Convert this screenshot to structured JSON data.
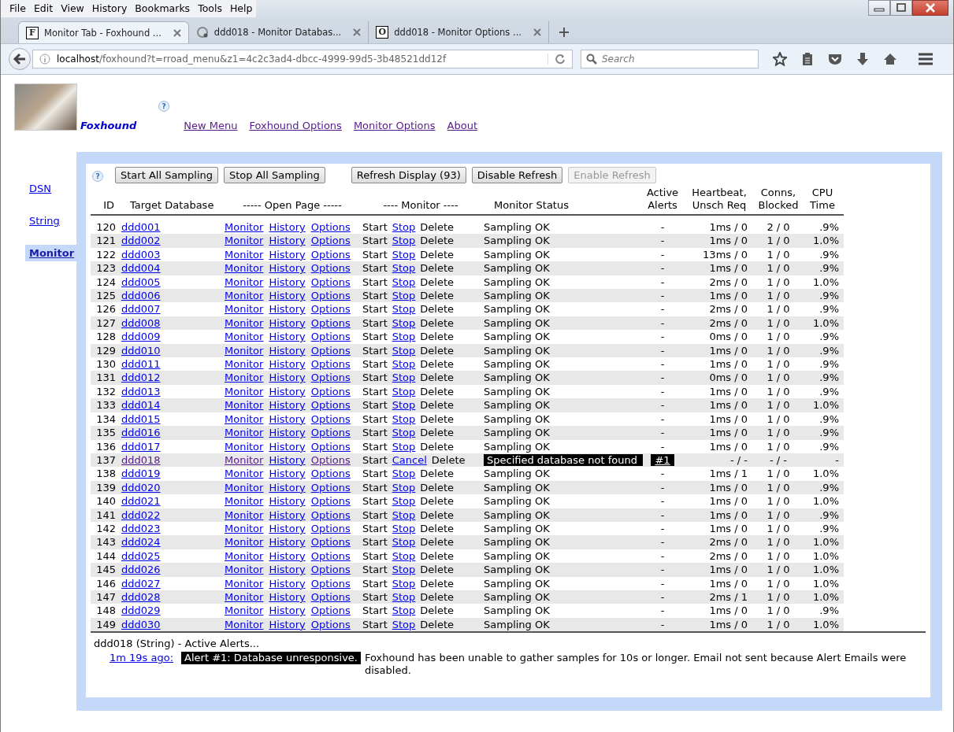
{
  "menu": [
    "File",
    "Edit",
    "View",
    "History",
    "Bookmarks",
    "Tools",
    "Help"
  ],
  "tabs": [
    {
      "label": "Monitor Tab - Foxhound ...",
      "kind": "letter",
      "letter": "F",
      "selected": true
    },
    {
      "label": "ddd018 - Monitor Databas...",
      "kind": "spinner",
      "selected": false
    },
    {
      "label": "ddd018 - Monitor Options ...",
      "kind": "letter",
      "letter": "O",
      "selected": false
    }
  ],
  "address": {
    "host": "localhost",
    "path": "/foxhound?t=rroad_menu&z1=4c2c3ad4-dbcc-4999-99d5-3b48521dd12f"
  },
  "search": {
    "placeholder": "Search"
  },
  "header": {
    "title": "Foxhound",
    "help": "?",
    "links": [
      {
        "label": "New Menu",
        "visited": true
      },
      {
        "label": "Foxhound Options",
        "visited": true
      },
      {
        "label": "Monitor Options",
        "visited": true
      },
      {
        "label": "About",
        "visited": true
      }
    ]
  },
  "sidebar": [
    {
      "label": "DSN",
      "selected": false
    },
    {
      "label": "String",
      "selected": false
    },
    {
      "label": "Monitor",
      "selected": true
    }
  ],
  "toolbar": {
    "help": "?",
    "buttons": [
      {
        "label": "Start All Sampling",
        "disabled": false
      },
      {
        "label": "Stop All Sampling",
        "disabled": false
      },
      {
        "label": "Refresh Display (93)",
        "disabled": false
      },
      {
        "label": "Disable Refresh",
        "disabled": false
      },
      {
        "label": "Enable Refresh",
        "disabled": true
      }
    ]
  },
  "columns": [
    [
      "ID"
    ],
    [
      "Target Database"
    ],
    [
      "----- Open Page -----"
    ],
    [
      "---- Monitor ----"
    ],
    [
      "Monitor Status"
    ],
    [
      "Active",
      "Alerts"
    ],
    [
      "Heartbeat,",
      "Unsch Req"
    ],
    [
      "Conns,",
      "Blocked"
    ],
    [
      "CPU",
      "Time"
    ]
  ],
  "rows": [
    {
      "id": "120",
      "db": "ddd001",
      "visited": false,
      "links": [
        "Monitor",
        "History",
        "Options"
      ],
      "start": "Start",
      "control": "Stop",
      "delete": "Delete",
      "status": "Sampling OK",
      "error": false,
      "alerts": "-",
      "alert_link": false,
      "heartbeat": "1ms / 0",
      "conns": "2 / 0",
      "cpu": ".9%"
    },
    {
      "id": "121",
      "db": "ddd002",
      "visited": false,
      "links": [
        "Monitor",
        "History",
        "Options"
      ],
      "start": "Start",
      "control": "Stop",
      "delete": "Delete",
      "status": "Sampling OK",
      "error": false,
      "alerts": "-",
      "alert_link": false,
      "heartbeat": "1ms / 0",
      "conns": "1 / 0",
      "cpu": "1.0%"
    },
    {
      "id": "122",
      "db": "ddd003",
      "visited": false,
      "links": [
        "Monitor",
        "History",
        "Options"
      ],
      "start": "Start",
      "control": "Stop",
      "delete": "Delete",
      "status": "Sampling OK",
      "error": false,
      "alerts": "-",
      "alert_link": false,
      "heartbeat": "13ms / 0",
      "conns": "1 / 0",
      "cpu": ".9%"
    },
    {
      "id": "123",
      "db": "ddd004",
      "visited": false,
      "links": [
        "Monitor",
        "History",
        "Options"
      ],
      "start": "Start",
      "control": "Stop",
      "delete": "Delete",
      "status": "Sampling OK",
      "error": false,
      "alerts": "-",
      "alert_link": false,
      "heartbeat": "1ms / 0",
      "conns": "1 / 0",
      "cpu": ".9%"
    },
    {
      "id": "124",
      "db": "ddd005",
      "visited": false,
      "links": [
        "Monitor",
        "History",
        "Options"
      ],
      "start": "Start",
      "control": "Stop",
      "delete": "Delete",
      "status": "Sampling OK",
      "error": false,
      "alerts": "-",
      "alert_link": false,
      "heartbeat": "2ms / 0",
      "conns": "1 / 0",
      "cpu": "1.0%"
    },
    {
      "id": "125",
      "db": "ddd006",
      "visited": false,
      "links": [
        "Monitor",
        "History",
        "Options"
      ],
      "start": "Start",
      "control": "Stop",
      "delete": "Delete",
      "status": "Sampling OK",
      "error": false,
      "alerts": "-",
      "alert_link": false,
      "heartbeat": "1ms / 0",
      "conns": "1 / 0",
      "cpu": ".9%"
    },
    {
      "id": "126",
      "db": "ddd007",
      "visited": false,
      "links": [
        "Monitor",
        "History",
        "Options"
      ],
      "start": "Start",
      "control": "Stop",
      "delete": "Delete",
      "status": "Sampling OK",
      "error": false,
      "alerts": "-",
      "alert_link": false,
      "heartbeat": "2ms / 0",
      "conns": "1 / 0",
      "cpu": ".9%"
    },
    {
      "id": "127",
      "db": "ddd008",
      "visited": false,
      "links": [
        "Monitor",
        "History",
        "Options"
      ],
      "start": "Start",
      "control": "Stop",
      "delete": "Delete",
      "status": "Sampling OK",
      "error": false,
      "alerts": "-",
      "alert_link": false,
      "heartbeat": "2ms / 0",
      "conns": "1 / 0",
      "cpu": "1.0%"
    },
    {
      "id": "128",
      "db": "ddd009",
      "visited": false,
      "links": [
        "Monitor",
        "History",
        "Options"
      ],
      "start": "Start",
      "control": "Stop",
      "delete": "Delete",
      "status": "Sampling OK",
      "error": false,
      "alerts": "-",
      "alert_link": false,
      "heartbeat": "0ms / 0",
      "conns": "1 / 0",
      "cpu": ".9%"
    },
    {
      "id": "129",
      "db": "ddd010",
      "visited": false,
      "links": [
        "Monitor",
        "History",
        "Options"
      ],
      "start": "Start",
      "control": "Stop",
      "delete": "Delete",
      "status": "Sampling OK",
      "error": false,
      "alerts": "-",
      "alert_link": false,
      "heartbeat": "1ms / 0",
      "conns": "1 / 0",
      "cpu": ".9%"
    },
    {
      "id": "130",
      "db": "ddd011",
      "visited": false,
      "links": [
        "Monitor",
        "History",
        "Options"
      ],
      "start": "Start",
      "control": "Stop",
      "delete": "Delete",
      "status": "Sampling OK",
      "error": false,
      "alerts": "-",
      "alert_link": false,
      "heartbeat": "1ms / 0",
      "conns": "1 / 0",
      "cpu": ".9%"
    },
    {
      "id": "131",
      "db": "ddd012",
      "visited": false,
      "links": [
        "Monitor",
        "History",
        "Options"
      ],
      "start": "Start",
      "control": "Stop",
      "delete": "Delete",
      "status": "Sampling OK",
      "error": false,
      "alerts": "-",
      "alert_link": false,
      "heartbeat": "0ms / 0",
      "conns": "1 / 0",
      "cpu": ".9%"
    },
    {
      "id": "132",
      "db": "ddd013",
      "visited": false,
      "links": [
        "Monitor",
        "History",
        "Options"
      ],
      "start": "Start",
      "control": "Stop",
      "delete": "Delete",
      "status": "Sampling OK",
      "error": false,
      "alerts": "-",
      "alert_link": false,
      "heartbeat": "1ms / 0",
      "conns": "1 / 0",
      "cpu": ".9%"
    },
    {
      "id": "133",
      "db": "ddd014",
      "visited": false,
      "links": [
        "Monitor",
        "History",
        "Options"
      ],
      "start": "Start",
      "control": "Stop",
      "delete": "Delete",
      "status": "Sampling OK",
      "error": false,
      "alerts": "-",
      "alert_link": false,
      "heartbeat": "1ms / 0",
      "conns": "1 / 0",
      "cpu": "1.0%"
    },
    {
      "id": "134",
      "db": "ddd015",
      "visited": false,
      "links": [
        "Monitor",
        "History",
        "Options"
      ],
      "start": "Start",
      "control": "Stop",
      "delete": "Delete",
      "status": "Sampling OK",
      "error": false,
      "alerts": "-",
      "alert_link": false,
      "heartbeat": "1ms / 0",
      "conns": "1 / 0",
      "cpu": ".9%"
    },
    {
      "id": "135",
      "db": "ddd016",
      "visited": false,
      "links": [
        "Monitor",
        "History",
        "Options"
      ],
      "start": "Start",
      "control": "Stop",
      "delete": "Delete",
      "status": "Sampling OK",
      "error": false,
      "alerts": "-",
      "alert_link": false,
      "heartbeat": "1ms / 0",
      "conns": "1 / 0",
      "cpu": ".9%"
    },
    {
      "id": "136",
      "db": "ddd017",
      "visited": false,
      "links": [
        "Monitor",
        "History",
        "Options"
      ],
      "start": "Start",
      "control": "Stop",
      "delete": "Delete",
      "status": "Sampling OK",
      "error": false,
      "alerts": "-",
      "alert_link": false,
      "heartbeat": "1ms / 0",
      "conns": "1 / 0",
      "cpu": ".9%"
    },
    {
      "id": "137",
      "db": "ddd018",
      "visited": true,
      "links": [
        "Monitor",
        "History",
        "Options"
      ],
      "start": "Start",
      "control": "Cancel",
      "delete": "Delete",
      "status": "Specified database not found",
      "error": true,
      "alerts": "#1",
      "alert_link": true,
      "heartbeat": "- / -",
      "conns": "- / -",
      "cpu": "-"
    },
    {
      "id": "138",
      "db": "ddd019",
      "visited": false,
      "links": [
        "Monitor",
        "History",
        "Options"
      ],
      "start": "Start",
      "control": "Stop",
      "delete": "Delete",
      "status": "Sampling OK",
      "error": false,
      "alerts": "-",
      "alert_link": false,
      "heartbeat": "1ms / 1",
      "conns": "1 / 0",
      "cpu": "1.0%"
    },
    {
      "id": "139",
      "db": "ddd020",
      "visited": false,
      "links": [
        "Monitor",
        "History",
        "Options"
      ],
      "start": "Start",
      "control": "Stop",
      "delete": "Delete",
      "status": "Sampling OK",
      "error": false,
      "alerts": "-",
      "alert_link": false,
      "heartbeat": "1ms / 0",
      "conns": "1 / 0",
      "cpu": ".9%"
    },
    {
      "id": "140",
      "db": "ddd021",
      "visited": false,
      "links": [
        "Monitor",
        "History",
        "Options"
      ],
      "start": "Start",
      "control": "Stop",
      "delete": "Delete",
      "status": "Sampling OK",
      "error": false,
      "alerts": "-",
      "alert_link": false,
      "heartbeat": "1ms / 0",
      "conns": "1 / 0",
      "cpu": "1.0%"
    },
    {
      "id": "141",
      "db": "ddd022",
      "visited": false,
      "links": [
        "Monitor",
        "History",
        "Options"
      ],
      "start": "Start",
      "control": "Stop",
      "delete": "Delete",
      "status": "Sampling OK",
      "error": false,
      "alerts": "-",
      "alert_link": false,
      "heartbeat": "1ms / 0",
      "conns": "1 / 0",
      "cpu": ".9%"
    },
    {
      "id": "142",
      "db": "ddd023",
      "visited": false,
      "links": [
        "Monitor",
        "History",
        "Options"
      ],
      "start": "Start",
      "control": "Stop",
      "delete": "Delete",
      "status": "Sampling OK",
      "error": false,
      "alerts": "-",
      "alert_link": false,
      "heartbeat": "1ms / 0",
      "conns": "1 / 0",
      "cpu": ".9%"
    },
    {
      "id": "143",
      "db": "ddd024",
      "visited": false,
      "links": [
        "Monitor",
        "History",
        "Options"
      ],
      "start": "Start",
      "control": "Stop",
      "delete": "Delete",
      "status": "Sampling OK",
      "error": false,
      "alerts": "-",
      "alert_link": false,
      "heartbeat": "2ms / 0",
      "conns": "1 / 0",
      "cpu": "1.0%"
    },
    {
      "id": "144",
      "db": "ddd025",
      "visited": false,
      "links": [
        "Monitor",
        "History",
        "Options"
      ],
      "start": "Start",
      "control": "Stop",
      "delete": "Delete",
      "status": "Sampling OK",
      "error": false,
      "alerts": "-",
      "alert_link": false,
      "heartbeat": "2ms / 0",
      "conns": "1 / 0",
      "cpu": "1.0%"
    },
    {
      "id": "145",
      "db": "ddd026",
      "visited": false,
      "links": [
        "Monitor",
        "History",
        "Options"
      ],
      "start": "Start",
      "control": "Stop",
      "delete": "Delete",
      "status": "Sampling OK",
      "error": false,
      "alerts": "-",
      "alert_link": false,
      "heartbeat": "1ms / 0",
      "conns": "1 / 0",
      "cpu": "1.0%"
    },
    {
      "id": "146",
      "db": "ddd027",
      "visited": false,
      "links": [
        "Monitor",
        "History",
        "Options"
      ],
      "start": "Start",
      "control": "Stop",
      "delete": "Delete",
      "status": "Sampling OK",
      "error": false,
      "alerts": "-",
      "alert_link": false,
      "heartbeat": "1ms / 0",
      "conns": "1 / 0",
      "cpu": "1.0%"
    },
    {
      "id": "147",
      "db": "ddd028",
      "visited": false,
      "links": [
        "Monitor",
        "History",
        "Options"
      ],
      "start": "Start",
      "control": "Stop",
      "delete": "Delete",
      "status": "Sampling OK",
      "error": false,
      "alerts": "-",
      "alert_link": false,
      "heartbeat": "2ms / 1",
      "conns": "1 / 0",
      "cpu": "1.0%"
    },
    {
      "id": "148",
      "db": "ddd029",
      "visited": false,
      "links": [
        "Monitor",
        "History",
        "Options"
      ],
      "start": "Start",
      "control": "Stop",
      "delete": "Delete",
      "status": "Sampling OK",
      "error": false,
      "alerts": "-",
      "alert_link": false,
      "heartbeat": "1ms / 0",
      "conns": "1 / 0",
      "cpu": ".9%"
    },
    {
      "id": "149",
      "db": "ddd030",
      "visited": false,
      "links": [
        "Monitor",
        "History",
        "Options"
      ],
      "start": "Start",
      "control": "Stop",
      "delete": "Delete",
      "status": "Sampling OK",
      "error": false,
      "alerts": "-",
      "alert_link": false,
      "heartbeat": "1ms / 0",
      "conns": "1 / 0",
      "cpu": "1.0%"
    }
  ],
  "alerts": {
    "heading": "ddd018 (String) - Active Alerts...",
    "items": [
      {
        "time": "1m 19s ago:",
        "badge": "Alert #1: Database unresponsive.",
        "text": "Foxhound has been unable to gather samples for 10s or longer. Email not sent because Alert Emails were disabled."
      }
    ]
  }
}
